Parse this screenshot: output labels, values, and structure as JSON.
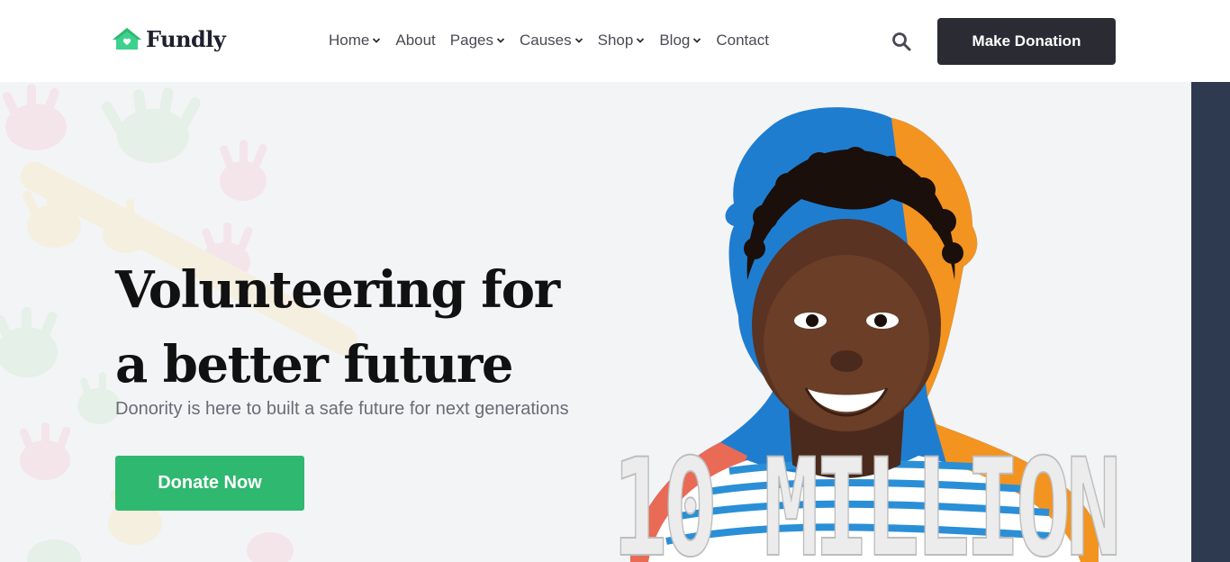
{
  "brand": {
    "name": "Fundly",
    "accent": "#2fb86f",
    "logo_icon": "house-heart-icon"
  },
  "nav": {
    "items": [
      {
        "label": "Home",
        "has_dropdown": true
      },
      {
        "label": "About",
        "has_dropdown": false
      },
      {
        "label": "Pages",
        "has_dropdown": true
      },
      {
        "label": "Causes",
        "has_dropdown": true
      },
      {
        "label": "Shop",
        "has_dropdown": true
      },
      {
        "label": "Blog",
        "has_dropdown": true
      },
      {
        "label": "Contact",
        "has_dropdown": false
      }
    ],
    "search_icon": "search-icon",
    "cta_label": "Make Donation",
    "cta_color": "#2b2b33"
  },
  "hero": {
    "title_line1": "Volunteering for",
    "title_line2": "a better future",
    "subtitle": "Donority is here to built a safe future for next generations",
    "cta_label": "Donate Now",
    "cta_color": "#2fb86f",
    "image_text": "10 MILLION",
    "background": "#f3f4f6",
    "side_strip_color": "#2d3a4f"
  }
}
